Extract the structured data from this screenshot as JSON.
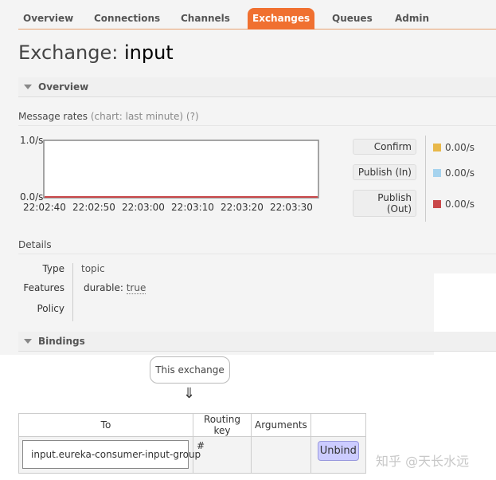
{
  "nav": {
    "tabs": [
      {
        "label": "Overview",
        "active": false
      },
      {
        "label": "Connections",
        "active": false
      },
      {
        "label": "Channels",
        "active": false
      },
      {
        "label": "Exchanges",
        "active": true
      },
      {
        "label": "Queues",
        "active": false
      },
      {
        "label": "Admin",
        "active": false
      }
    ]
  },
  "page": {
    "title_prefix": "Exchange: ",
    "title_name": "input"
  },
  "overview": {
    "heading": "Overview",
    "message_rates_label": "Message rates",
    "chart_note": "(chart: last minute) (?)",
    "legend": [
      {
        "label": "Confirm",
        "rate": "0.00/s",
        "color": "#e8b84a"
      },
      {
        "label": "Publish (In)",
        "rate": "0.00/s",
        "color": "#a6d3ee"
      },
      {
        "label_line1": "Publish",
        "label_line2": "(Out)",
        "rate": "0.00/s",
        "color": "#c9484a"
      }
    ]
  },
  "chart_data": {
    "type": "line",
    "x": [
      "22:02:40",
      "22:02:50",
      "22:03:00",
      "22:03:10",
      "22:03:20",
      "22:03:30"
    ],
    "yticks": [
      "1.0/s",
      "0.0/s"
    ],
    "ylim": [
      0,
      1
    ],
    "series": [
      {
        "name": "Confirm",
        "values": [
          0,
          0,
          0,
          0,
          0,
          0
        ],
        "color": "#e8b84a"
      },
      {
        "name": "Publish (In)",
        "values": [
          0,
          0,
          0,
          0,
          0,
          0
        ],
        "color": "#a6d3ee"
      },
      {
        "name": "Publish (Out)",
        "values": [
          0,
          0,
          0,
          0,
          0,
          0
        ],
        "color": "#c9484a"
      }
    ]
  },
  "details": {
    "heading": "Details",
    "type_label": "Type",
    "type_value": "topic",
    "features_label": "Features",
    "features_key": "durable:",
    "features_value": "true",
    "policy_label": "Policy"
  },
  "bindings": {
    "heading": "Bindings",
    "this_exchange": "This exchange",
    "arrow": "⇓",
    "columns": [
      "To",
      "Routing key",
      "Arguments"
    ],
    "rows": [
      {
        "to": "input.eureka-consumer-input-group",
        "routing_key": "#",
        "arguments": "",
        "unbind_label": "Unbind"
      }
    ]
  },
  "watermark": "知乎 @天长水远"
}
